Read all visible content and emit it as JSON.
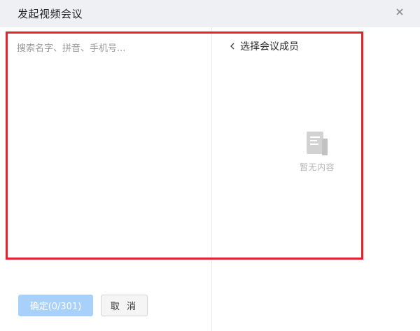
{
  "dialog": {
    "title": "发起视频会议",
    "close_icon": "close-icon"
  },
  "search": {
    "placeholder": "搜索名字、拼音、手机号..."
  },
  "members": {
    "header_label": "选择会议成员",
    "back_icon": "chevron-left-icon",
    "empty_icon": "document-icon",
    "empty_text": "暂无内容"
  },
  "footer": {
    "confirm_label": "确定(0/301)",
    "cancel_label": "取 消"
  },
  "colors": {
    "header_bg": "#eef0f3",
    "highlight_border": "#e0242f",
    "confirm_disabled_bg": "#a7d0fb",
    "empty_text": "#b5b5b5"
  }
}
